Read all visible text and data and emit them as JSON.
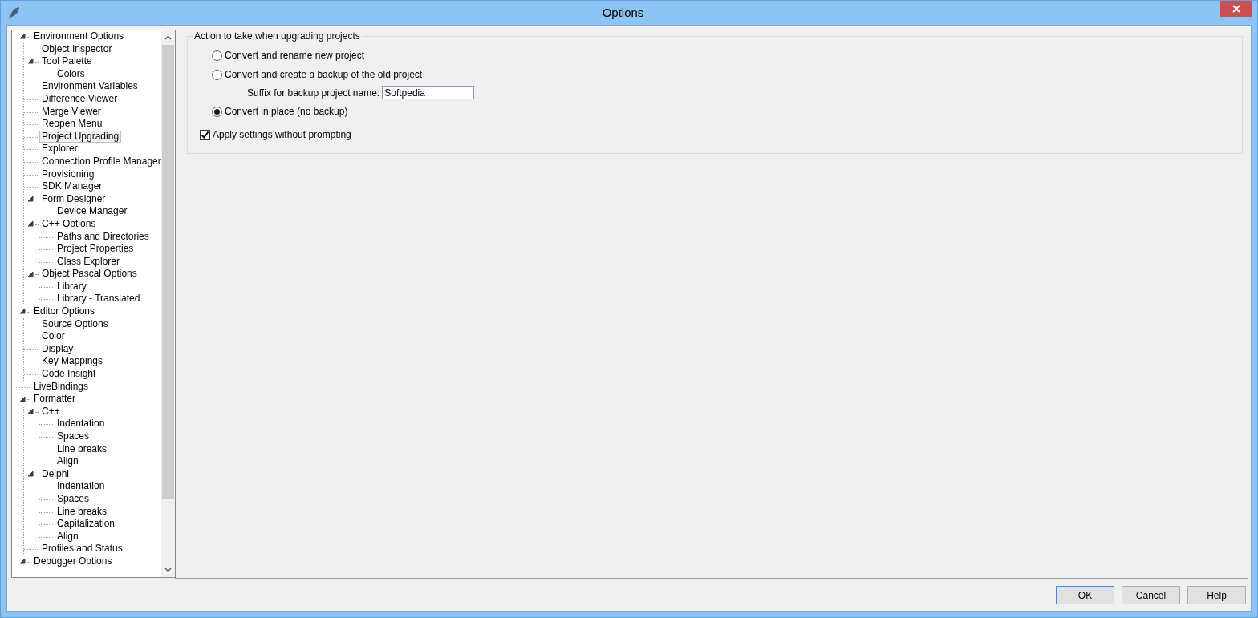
{
  "window": {
    "title": "Options"
  },
  "tree": [
    {
      "label": "Environment Options",
      "selected": false,
      "expanded": true,
      "children": [
        {
          "label": "Object Inspector",
          "selected": false
        },
        {
          "label": "Tool Palette",
          "selected": false,
          "expanded": true,
          "children": [
            {
              "label": "Colors",
              "selected": false
            }
          ]
        },
        {
          "label": "Environment Variables",
          "selected": false
        },
        {
          "label": "Difference Viewer",
          "selected": false
        },
        {
          "label": "Merge Viewer",
          "selected": false
        },
        {
          "label": "Reopen Menu",
          "selected": false
        },
        {
          "label": "Project Upgrading",
          "selected": true
        },
        {
          "label": "Explorer",
          "selected": false
        },
        {
          "label": "Connection Profile Manager",
          "selected": false
        },
        {
          "label": "Provisioning",
          "selected": false
        },
        {
          "label": "SDK Manager",
          "selected": false
        },
        {
          "label": "Form Designer",
          "selected": false,
          "expanded": true,
          "children": [
            {
              "label": "Device Manager",
              "selected": false
            }
          ]
        },
        {
          "label": "C++ Options",
          "selected": false,
          "expanded": true,
          "children": [
            {
              "label": "Paths and Directories",
              "selected": false
            },
            {
              "label": "Project Properties",
              "selected": false
            },
            {
              "label": "Class Explorer",
              "selected": false
            }
          ]
        },
        {
          "label": "Object Pascal Options",
          "selected": false,
          "expanded": true,
          "children": [
            {
              "label": "Library",
              "selected": false
            },
            {
              "label": "Library - Translated",
              "selected": false
            }
          ]
        }
      ]
    },
    {
      "label": "Editor Options",
      "selected": false,
      "expanded": true,
      "children": [
        {
          "label": "Source Options",
          "selected": false
        },
        {
          "label": "Color",
          "selected": false
        },
        {
          "label": "Display",
          "selected": false
        },
        {
          "label": "Key Mappings",
          "selected": false
        },
        {
          "label": "Code Insight",
          "selected": false
        }
      ]
    },
    {
      "label": "LiveBindings",
      "selected": false
    },
    {
      "label": "Formatter",
      "selected": false,
      "expanded": true,
      "children": [
        {
          "label": "C++",
          "selected": false,
          "expanded": true,
          "children": [
            {
              "label": "Indentation",
              "selected": false
            },
            {
              "label": "Spaces",
              "selected": false
            },
            {
              "label": "Line breaks",
              "selected": false
            },
            {
              "label": "Align",
              "selected": false
            }
          ]
        },
        {
          "label": "Delphi",
          "selected": false,
          "expanded": true,
          "children": [
            {
              "label": "Indentation",
              "selected": false
            },
            {
              "label": "Spaces",
              "selected": false
            },
            {
              "label": "Line breaks",
              "selected": false
            },
            {
              "label": "Capitalization",
              "selected": false
            },
            {
              "label": "Align",
              "selected": false
            }
          ]
        },
        {
          "label": "Profiles and Status",
          "selected": false
        }
      ]
    },
    {
      "label": "Debugger Options",
      "selected": false,
      "expanded": true
    }
  ],
  "options_panel": {
    "group_title": "Action to take when upgrading projects",
    "options": [
      {
        "kind": "radio",
        "label": "Convert and rename new project",
        "selected": false
      },
      {
        "kind": "radio",
        "label": "Convert and create a backup of the old project",
        "selected": false,
        "field": {
          "label": "Suffix for backup project name:",
          "value": "Softpedia"
        }
      },
      {
        "kind": "radio",
        "label": "Convert in place (no backup)",
        "selected": true
      }
    ],
    "checkbox": {
      "label": "Apply settings without prompting",
      "checked": true
    }
  },
  "buttons": [
    {
      "label": "OK",
      "default": true
    },
    {
      "label": "Cancel",
      "default": false
    },
    {
      "label": "Help",
      "default": false
    }
  ]
}
